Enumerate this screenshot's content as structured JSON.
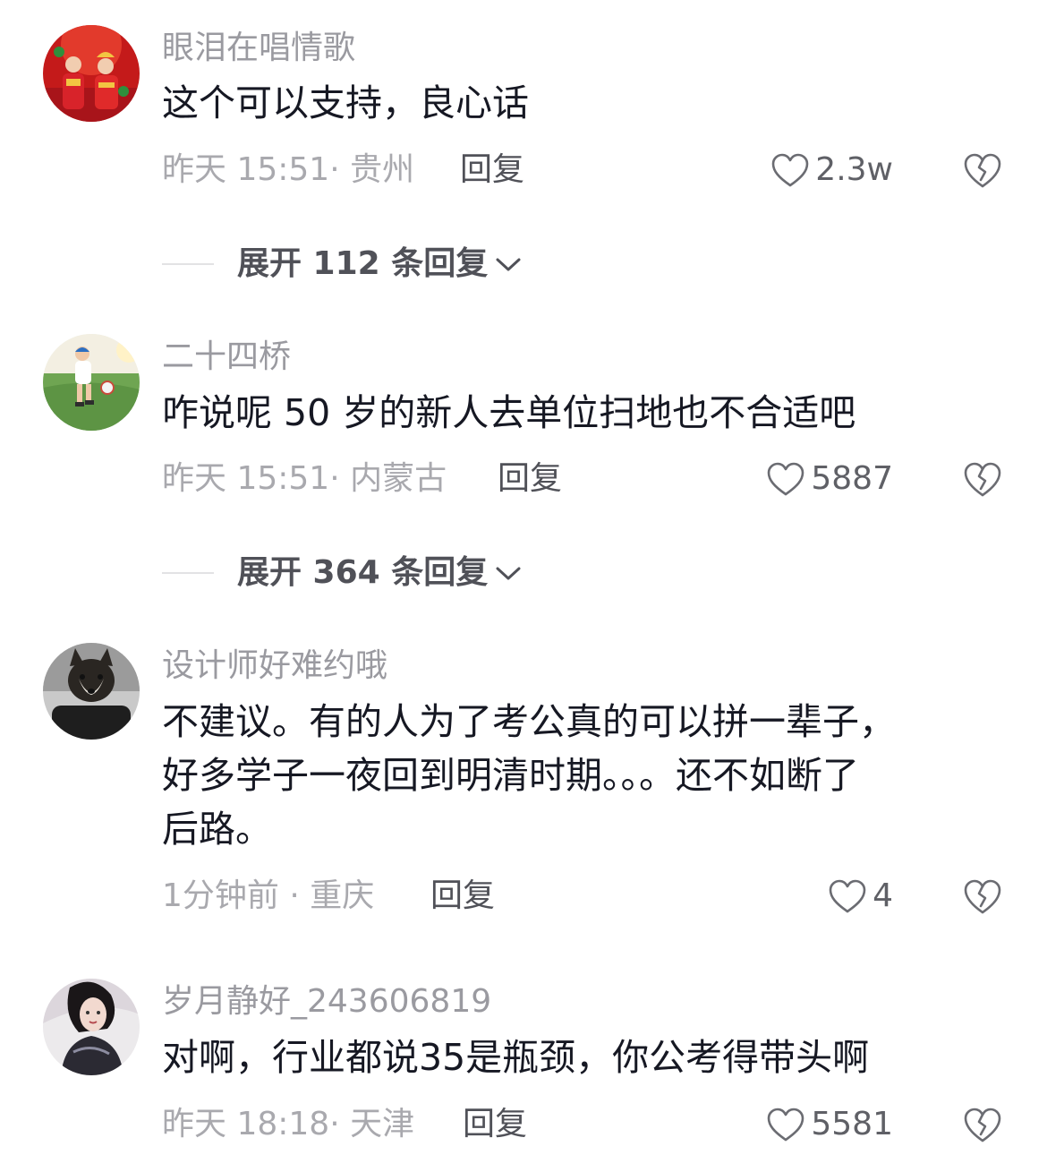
{
  "comments": [
    {
      "username": "眼泪在唱情歌",
      "lines": [
        "这个可以支持，良心话"
      ],
      "time_location": "昨天 15:51· 贵州",
      "reply_label": "回复",
      "likes": "2.3w",
      "expand_label": "展开 112 条回复",
      "avatar_icon": "wedding-couple-avatar"
    },
    {
      "username": "二十四桥",
      "lines": [
        "咋说呢 50 岁的新人去单位扫地也不合适吧"
      ],
      "time_location": "昨天 15:51· 内蒙古",
      "reply_label": "回复",
      "likes": "5887",
      "expand_label": "展开 364 条回复",
      "avatar_icon": "child-with-ball-avatar"
    },
    {
      "username": "设计师好难约哦",
      "lines": [
        "不建议。有的人为了考公真的可以拼一辈子，",
        "好多学子一夜回到明清时期。。。还不如断了",
        "后路。"
      ],
      "time_location": "1分钟前 · 重庆",
      "reply_label": "回复",
      "likes": "4",
      "avatar_icon": "shiba-dog-avatar"
    },
    {
      "username": "岁月静好_243606819",
      "lines": [
        "对啊，行业都说35是瓶颈，你公考得带头啊"
      ],
      "time_location": "昨天 18:18· 天津",
      "reply_label": "回复",
      "likes": "5581",
      "avatar_icon": "woman-portrait-avatar"
    }
  ],
  "icons": {
    "like": "heart-outline-icon",
    "dislike": "broken-heart-icon",
    "expand": "chevron-down-icon"
  },
  "colors": {
    "username": "#9a9aa0",
    "text": "#161823",
    "meta": "#a9a9ae",
    "reply": "#505158"
  }
}
